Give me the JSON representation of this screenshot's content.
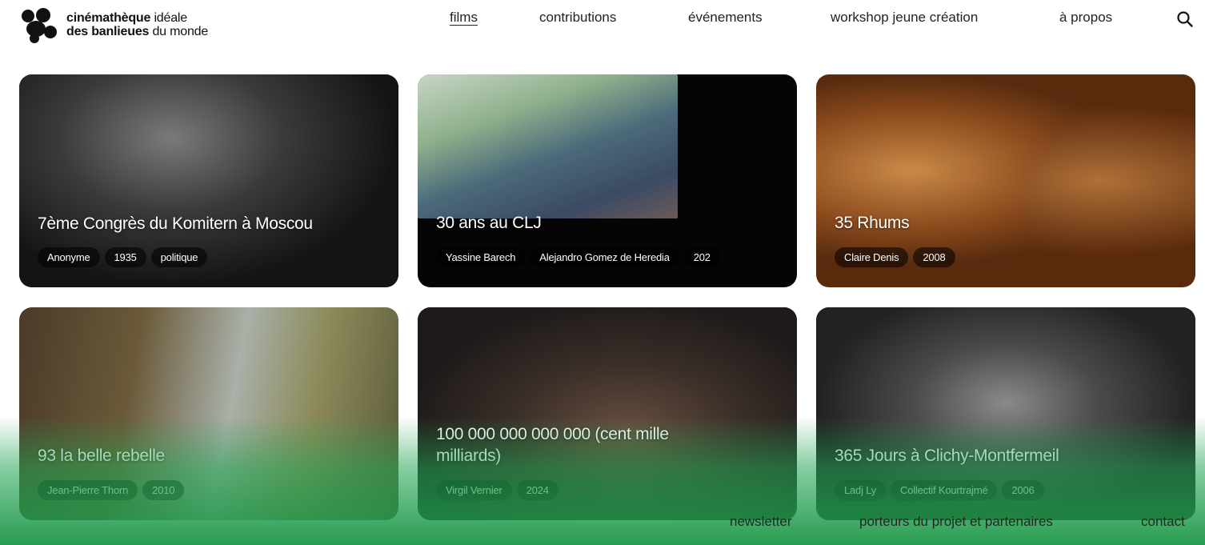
{
  "logo": {
    "line1_bold": "cinémathèque",
    "line1_light": "idéale",
    "line2_bold": "des banlieues",
    "line2_light": "du monde"
  },
  "nav": {
    "items": [
      {
        "label": "films",
        "active": true
      },
      {
        "label": "contributions"
      },
      {
        "label": "événements"
      },
      {
        "label": "workshop jeune création"
      },
      {
        "label": "à propos"
      }
    ],
    "search_icon": "search-icon"
  },
  "films": [
    {
      "title": "7ème Congrès du Komitern à Moscou",
      "tags": [
        "Anonyme",
        "1935",
        "politique"
      ]
    },
    {
      "title": "30 ans au CLJ",
      "tags": [
        "Yassine Barech",
        "Alejandro Gomez de Heredia",
        "202"
      ]
    },
    {
      "title": "35 Rhums",
      "tags": [
        "Claire Denis",
        "2008"
      ]
    },
    {
      "title": "93 la belle rebelle",
      "tags": [
        "Jean-Pierre Thorn",
        "2010"
      ]
    },
    {
      "title": "100 000 000 000 000 (cent mille milliards)",
      "tags": [
        "Virgil Vernier",
        "2024"
      ]
    },
    {
      "title": "365 Jours à Clichy-Montfermeil",
      "tags": [
        "Ladj Ly",
        "Collectif Kourtrajmé",
        "2006"
      ]
    }
  ],
  "footer": {
    "links": [
      "newsletter",
      "porteurs du projet et partenaires",
      "contact"
    ]
  },
  "colors": {
    "accent_green": "#1f9b4e",
    "text": "#111111"
  }
}
